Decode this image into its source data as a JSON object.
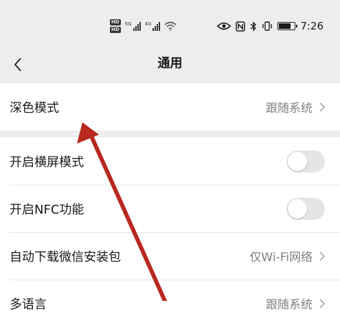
{
  "status_bar": {
    "hd_badges": [
      "HD",
      "HD"
    ],
    "signal_tags": [
      "5G",
      "4G"
    ],
    "time": "7:26",
    "icons": [
      "eye-icon",
      "nfc-icon",
      "bluetooth-icon",
      "vibrate-icon",
      "battery-icon"
    ]
  },
  "header": {
    "back_icon": "chevron-left-icon",
    "title": "通用"
  },
  "settings": {
    "dark_mode": {
      "label": "深色模式",
      "value": "跟随系统"
    },
    "landscape": {
      "label": "开启横屏模式",
      "enabled": false
    },
    "nfc": {
      "label": "开启NFC功能",
      "enabled": false
    },
    "auto_download": {
      "label": "自动下载微信安装包",
      "value": "仅Wi-Fi网络"
    },
    "language": {
      "label": "多语言",
      "value": "跟随系统"
    }
  },
  "annotation": {
    "type": "arrow",
    "color": "#b8291f",
    "points_to": "dark_mode"
  },
  "colors": {
    "background": "#ededed",
    "row_background": "#ffffff",
    "toggle_off": "#e5e5e5",
    "secondary_text": "#7f7f7f"
  }
}
